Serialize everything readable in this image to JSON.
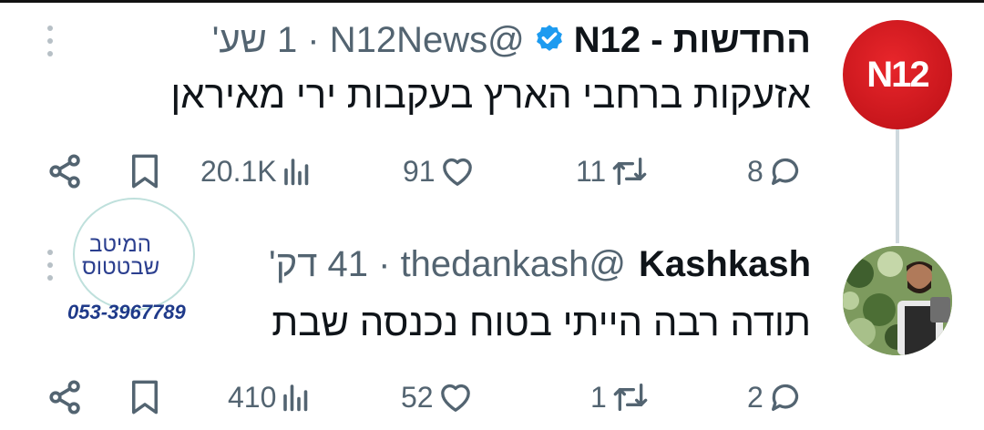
{
  "tweets": [
    {
      "display_name": "החדשות - N12",
      "handle": "@N12News",
      "time": "1 שע'",
      "verified": true,
      "avatar_text": "N12",
      "text": "אזעקות ברחבי הארץ בעקבות ירי מאיראן",
      "stats": {
        "replies": "8",
        "retweets": "11",
        "likes": "91",
        "views": "20.1K"
      }
    },
    {
      "display_name": "Kashkash",
      "handle": "@thedankash",
      "time": "41 דק'",
      "verified": false,
      "text": "תודה רבה הייתי בטוח נכנסה שבת",
      "stats": {
        "replies": "2",
        "retweets": "1",
        "likes": "52",
        "views": "410"
      }
    }
  ],
  "overlay_stamp": {
    "line1": "המיטב",
    "line2": "שבטטוס",
    "phone": "053-3967789"
  },
  "colors": {
    "n12_red": "#d01a20",
    "verified_blue": "#1d9bf0",
    "muted_text": "#536471",
    "thread_line": "#cfd9de"
  },
  "icons": [
    "reply-icon",
    "retweet-icon",
    "like-icon",
    "views-icon",
    "bookmark-icon",
    "share-icon",
    "verified-badge-icon",
    "more-icon"
  ]
}
